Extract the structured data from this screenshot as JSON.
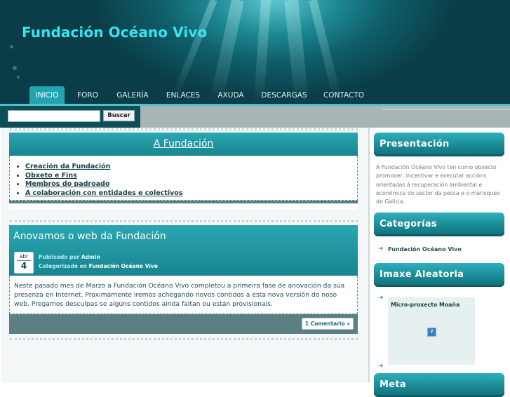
{
  "site": {
    "title": "Fundación Océano Vivo"
  },
  "nav": {
    "items": [
      {
        "label": "INICIO",
        "active": true
      },
      {
        "label": "FORO"
      },
      {
        "label": "GALERÍA"
      },
      {
        "label": "ENLACES"
      },
      {
        "label": "AXUDA"
      },
      {
        "label": "DESCARGAS"
      },
      {
        "label": "CONTACTO"
      }
    ]
  },
  "search": {
    "value": "",
    "button_label": "Buscar"
  },
  "page_box": {
    "title": "A Fundación",
    "links": [
      "Creación da Fundación",
      "Obxeto e Fins",
      "Membros do padroado",
      "A colaboración con entidades e colectivos"
    ]
  },
  "post": {
    "title": "Anovamos o web da Fundación",
    "date_month": "abr",
    "date_day": "4",
    "published_prefix": "Publicado por",
    "author": "Admin",
    "category_prefix": "Categorizado en",
    "category": "Fundación Océano Vivo",
    "body": "Neste pasado mes de Marzo a Fundación Océano Vivo completou a primeira fase de anovación da súa presenza en Internet. Proximamente iremos achegando novos contidos a esta nova versión do noso web. Pregamos desculpas se algúns contidos ainda faltan ou están provisionais.",
    "comments_label": "1 Comentario »"
  },
  "sidebar": {
    "presentacion": {
      "title": "Presentación",
      "text": "A Fundación Océano Vivo ten como obxecto promover, incentivar e executar accións orientadas á recuperación ambiental e económica do sector da pesca e o marisqueo de Galicia."
    },
    "categorias": {
      "title": "Categorías",
      "items": [
        "Fundación Océano Vivo"
      ]
    },
    "imaxe": {
      "title": "Imaxe Aleatoria",
      "caption": "Micro-proxecto Moaña"
    },
    "meta": {
      "title": "Meta"
    }
  },
  "colors": {
    "accent": "#1a8a95",
    "title": "#39e3ee",
    "header_dark": "#0a3d47"
  }
}
